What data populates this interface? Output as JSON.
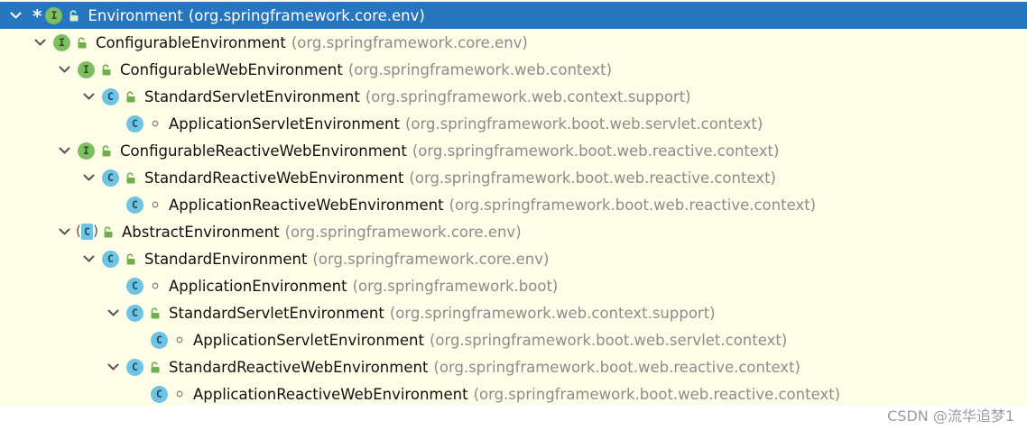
{
  "tree": {
    "rows": [
      {
        "expanded": true,
        "starred": true,
        "kind": "interface",
        "kind_letter": "I",
        "visibility": "public",
        "name": "Environment",
        "package": "(org.springframework.core.env)",
        "selected": true
      },
      {
        "expanded": true,
        "kind": "interface",
        "kind_letter": "I",
        "visibility": "public",
        "name": "ConfigurableEnvironment",
        "package": "(org.springframework.core.env)"
      },
      {
        "expanded": true,
        "kind": "interface",
        "kind_letter": "I",
        "visibility": "public",
        "name": "ConfigurableWebEnvironment",
        "package": "(org.springframework.web.context)"
      },
      {
        "expanded": true,
        "kind": "class",
        "kind_letter": "C",
        "visibility": "public",
        "name": "StandardServletEnvironment",
        "package": "(org.springframework.web.context.support)"
      },
      {
        "expanded": null,
        "kind": "class",
        "kind_letter": "C",
        "visibility": "package",
        "name": "ApplicationServletEnvironment",
        "package": "(org.springframework.boot.web.servlet.context)"
      },
      {
        "expanded": true,
        "kind": "interface",
        "kind_letter": "I",
        "visibility": "public",
        "name": "ConfigurableReactiveWebEnvironment",
        "package": "(org.springframework.boot.web.reactive.context)"
      },
      {
        "expanded": true,
        "kind": "class",
        "kind_letter": "C",
        "visibility": "public",
        "name": "StandardReactiveWebEnvironment",
        "package": "(org.springframework.boot.web.reactive.context)"
      },
      {
        "expanded": null,
        "kind": "class",
        "kind_letter": "C",
        "visibility": "package",
        "name": "ApplicationReactiveWebEnvironment",
        "package": "(org.springframework.boot.web.reactive.context)"
      },
      {
        "expanded": true,
        "kind": "abstract",
        "kind_letter": "C",
        "visibility": "public",
        "name": "AbstractEnvironment",
        "package": "(org.springframework.core.env)"
      },
      {
        "expanded": true,
        "kind": "class",
        "kind_letter": "C",
        "visibility": "public",
        "name": "StandardEnvironment",
        "package": "(org.springframework.core.env)"
      },
      {
        "expanded": null,
        "kind": "class",
        "kind_letter": "C",
        "visibility": "package",
        "name": "ApplicationEnvironment",
        "package": "(org.springframework.boot)"
      },
      {
        "expanded": true,
        "kind": "class",
        "kind_letter": "C",
        "visibility": "public",
        "name": "StandardServletEnvironment",
        "package": "(org.springframework.web.context.support)"
      },
      {
        "expanded": null,
        "kind": "class",
        "kind_letter": "C",
        "visibility": "package",
        "name": "ApplicationServletEnvironment",
        "package": "(org.springframework.boot.web.servlet.context)"
      },
      {
        "expanded": true,
        "kind": "class",
        "kind_letter": "C",
        "visibility": "public",
        "name": "StandardReactiveWebEnvironment",
        "package": "(org.springframework.boot.web.reactive.context)"
      },
      {
        "expanded": null,
        "kind": "class",
        "kind_letter": "C",
        "visibility": "package",
        "name": "ApplicationReactiveWebEnvironment",
        "package": "(org.springframework.boot.web.reactive.context)"
      }
    ],
    "colors": {
      "background": "#fdfde8",
      "selection": "#2675bf",
      "interface_badge": "#7fbd62",
      "class_badge": "#6fc3e3",
      "lock": "#6fb04a",
      "package_text": "#8c8c8c"
    },
    "icons": {
      "expand": "chevron-down-icon",
      "interface": "interface-icon",
      "class": "class-icon",
      "abstract": "abstract-class-icon",
      "public": "unlocked-icon",
      "package": "package-private-icon"
    }
  },
  "watermark": "CSDN @流华追梦1"
}
